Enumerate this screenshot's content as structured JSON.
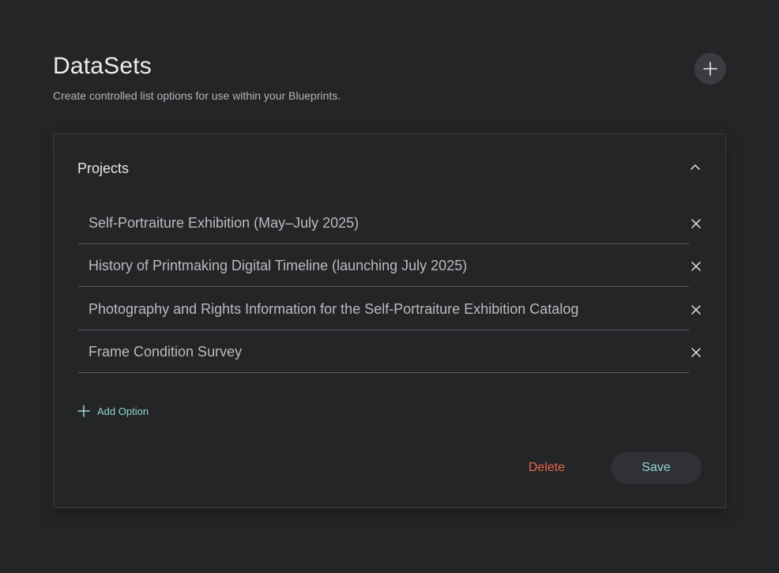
{
  "header": {
    "title": "DataSets",
    "subtitle": "Create controlled list options for use within your Blueprints."
  },
  "dataset": {
    "title": "Projects",
    "options": [
      "Self-Portraiture Exhibition (May–July 2025)",
      "History of Printmaking Digital Timeline (launching July 2025)",
      "Photography and Rights Information for the Self-Portraiture Exhibition Catalog",
      "Frame Condition Survey"
    ],
    "add_option_label": "Add Option",
    "delete_label": "Delete",
    "save_label": "Save"
  },
  "colors": {
    "background": "#242527",
    "accent": "#97d6d3",
    "danger": "#e9664f"
  },
  "icons": {
    "add_dataset": "plus-icon",
    "collapse": "chevron-up-icon",
    "remove_option": "close-icon",
    "add_option": "plus-icon"
  }
}
